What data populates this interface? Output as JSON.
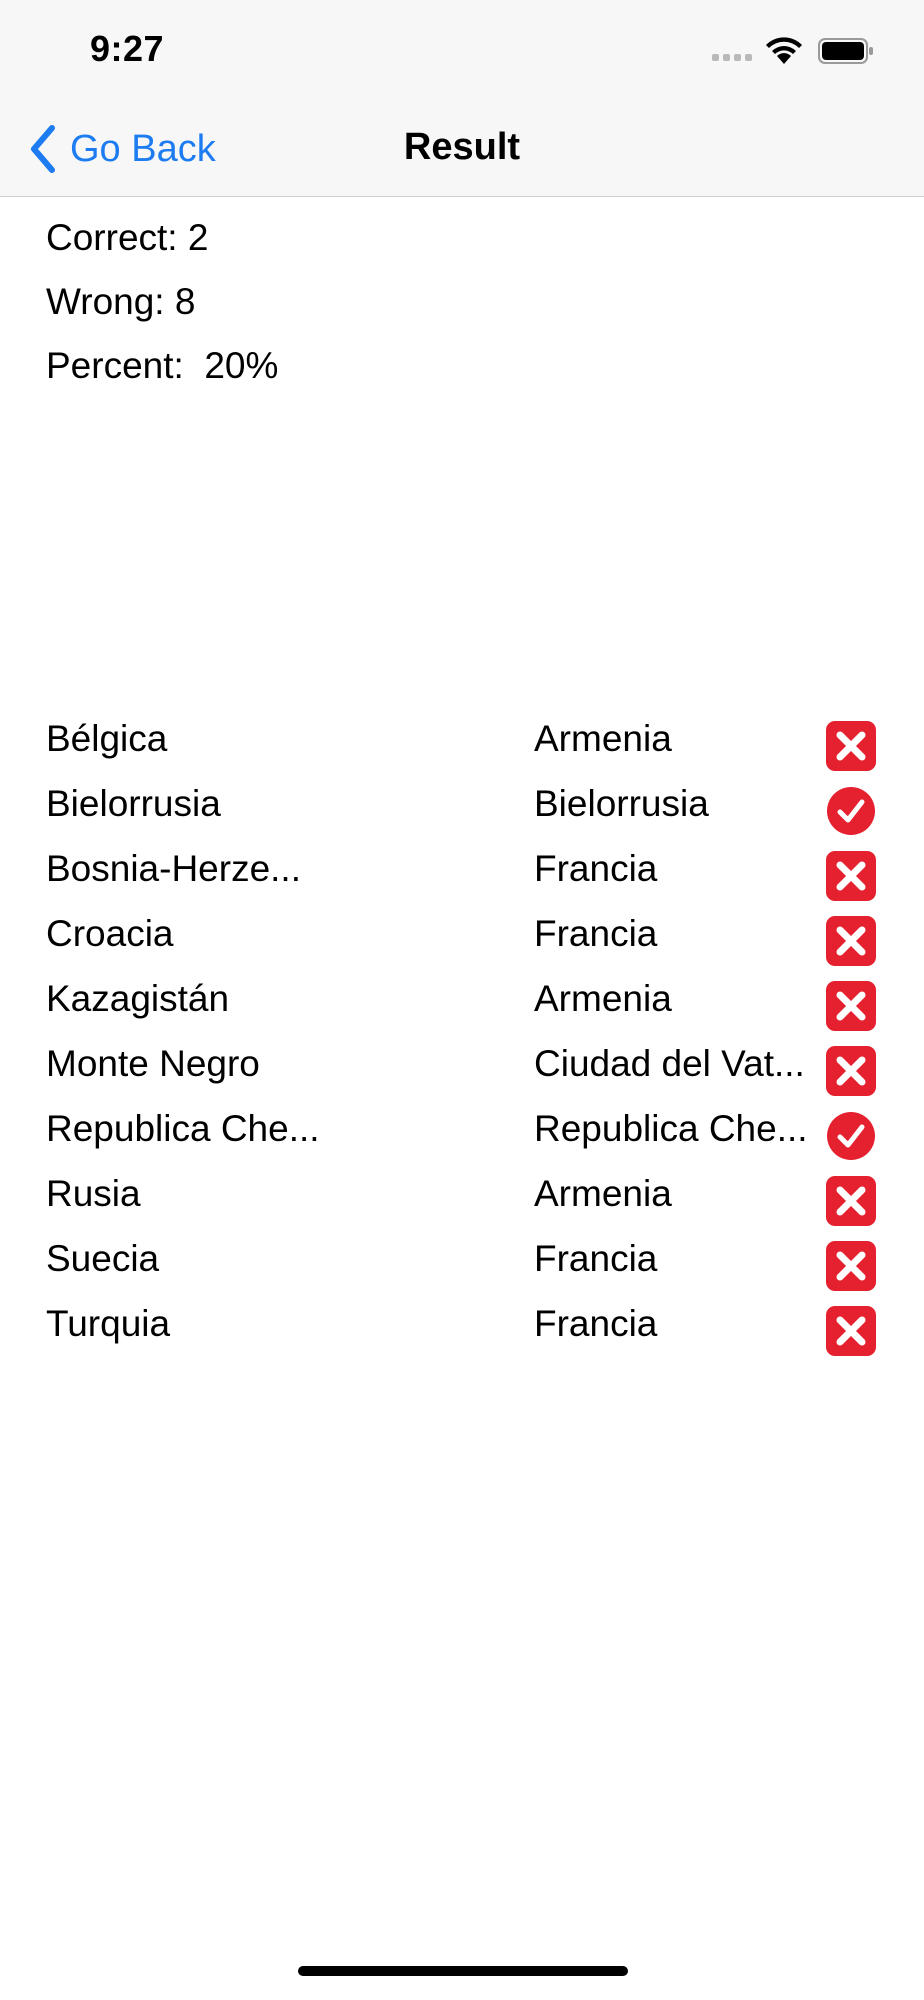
{
  "status_bar": {
    "time": "9:27"
  },
  "nav": {
    "back_label": "Go Back",
    "title": "Result"
  },
  "summary": {
    "correct": "Correct: 2",
    "wrong": "Wrong: 8",
    "percent": "Percent:  20%"
  },
  "results": [
    {
      "country": "Bélgica",
      "answer": "Armenia",
      "status": "wrong"
    },
    {
      "country": "Bielorrusia",
      "answer": "Bielorrusia",
      "status": "correct"
    },
    {
      "country": "Bosnia-Herze...",
      "answer": "Francia",
      "status": "wrong"
    },
    {
      "country": "Croacia",
      "answer": "Francia",
      "status": "wrong"
    },
    {
      "country": "Kazagistán",
      "answer": "Armenia",
      "status": "wrong"
    },
    {
      "country": "Monte Negro",
      "answer": "Ciudad del Vat...",
      "status": "wrong"
    },
    {
      "country": "Republica Che...",
      "answer": "Republica Che...",
      "status": "correct"
    },
    {
      "country": "Rusia",
      "answer": "Armenia",
      "status": "wrong"
    },
    {
      "country": "Suecia",
      "answer": "Francia",
      "status": "wrong"
    },
    {
      "country": "Turquia",
      "answer": "Francia",
      "status": "wrong"
    }
  ],
  "colors": {
    "accent": "#1d7cf2",
    "wrong_icon": "#e5202f",
    "correct_icon": "#e5202f"
  },
  "icons": {
    "wrong": "cross-mark-icon",
    "correct": "check-mark-icon"
  }
}
